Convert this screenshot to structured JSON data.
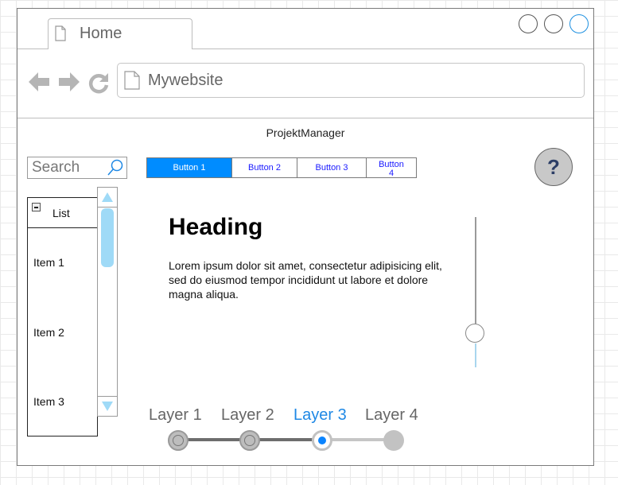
{
  "browser": {
    "tab_label": "Home",
    "url": "Mywebsite",
    "window_controls": [
      "minimize-icon",
      "maximize-icon",
      "close-icon"
    ]
  },
  "app": {
    "title": "ProjektManager"
  },
  "search": {
    "placeholder": "Search"
  },
  "toolbar": {
    "buttons": [
      "Button 1",
      "Button 2",
      "Button 3",
      "Button 4"
    ],
    "active_index": 0
  },
  "help": {
    "label": "?"
  },
  "list": {
    "title": "List",
    "items": [
      "Item 1",
      "Item 2",
      "Item 3"
    ]
  },
  "content": {
    "heading": "Heading",
    "paragraph": "Lorem ipsum dolor sit amet, consectetur adipisicing elit, sed do eiusmod tempor incididunt ut labore et dolore magna aliqua."
  },
  "vertical_slider": {
    "value_fraction": 0.25
  },
  "stepper": {
    "steps": [
      "Layer 1",
      "Layer 2",
      "Layer 3",
      "Layer 4"
    ],
    "current_index": 2
  },
  "colors": {
    "accent": "#008cff",
    "active_step": "#1e88e5",
    "scroll_thumb": "#9fdaf7"
  }
}
